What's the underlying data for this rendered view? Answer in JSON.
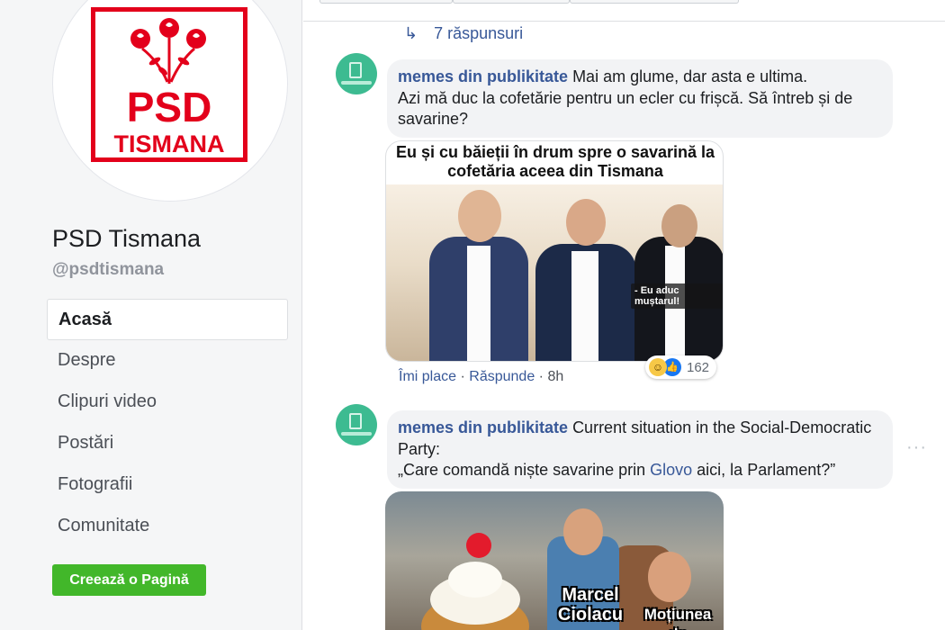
{
  "sidebar": {
    "page_name": "PSD Tismana",
    "page_handle": "@psdtismana",
    "logo": {
      "line1": "PSD",
      "line2": "TISMANA",
      "color": "#e3001b"
    },
    "nav": [
      "Acasă",
      "Despre",
      "Clipuri video",
      "Postări",
      "Fotografii",
      "Comunitate"
    ],
    "create_button": "Creează o Pagină"
  },
  "feed": {
    "replies_link": "7 răspunsuri",
    "comment1": {
      "author": "memes din publikitate",
      "text_line1": "Mai am glume, dar asta e ultima.",
      "text_line2": "Azi mă duc la cofetărie pentru un ecler cu frișcă. Să întreb și de savarine?",
      "meme_caption": "Eu și cu băieții în drum spre o savarină la cofetăria aceea din Tismana",
      "meme_quote": "- Eu aduc muștarul!",
      "like_label": "Îmi place",
      "reply_label": "Răspunde",
      "time": "8h",
      "reaction_count": "162"
    },
    "comment2": {
      "author": "memes din publikitate",
      "text_line1": "Current situation in the Social-Democratic Party:",
      "text_quote_before": "„Care comandă niște savarine prin ",
      "text_link": "Glovo",
      "text_quote_after": " aici, la Parlament?”",
      "meme_label1": "Marcel Ciolacu",
      "meme_label2": "Moțiunea de"
    }
  }
}
